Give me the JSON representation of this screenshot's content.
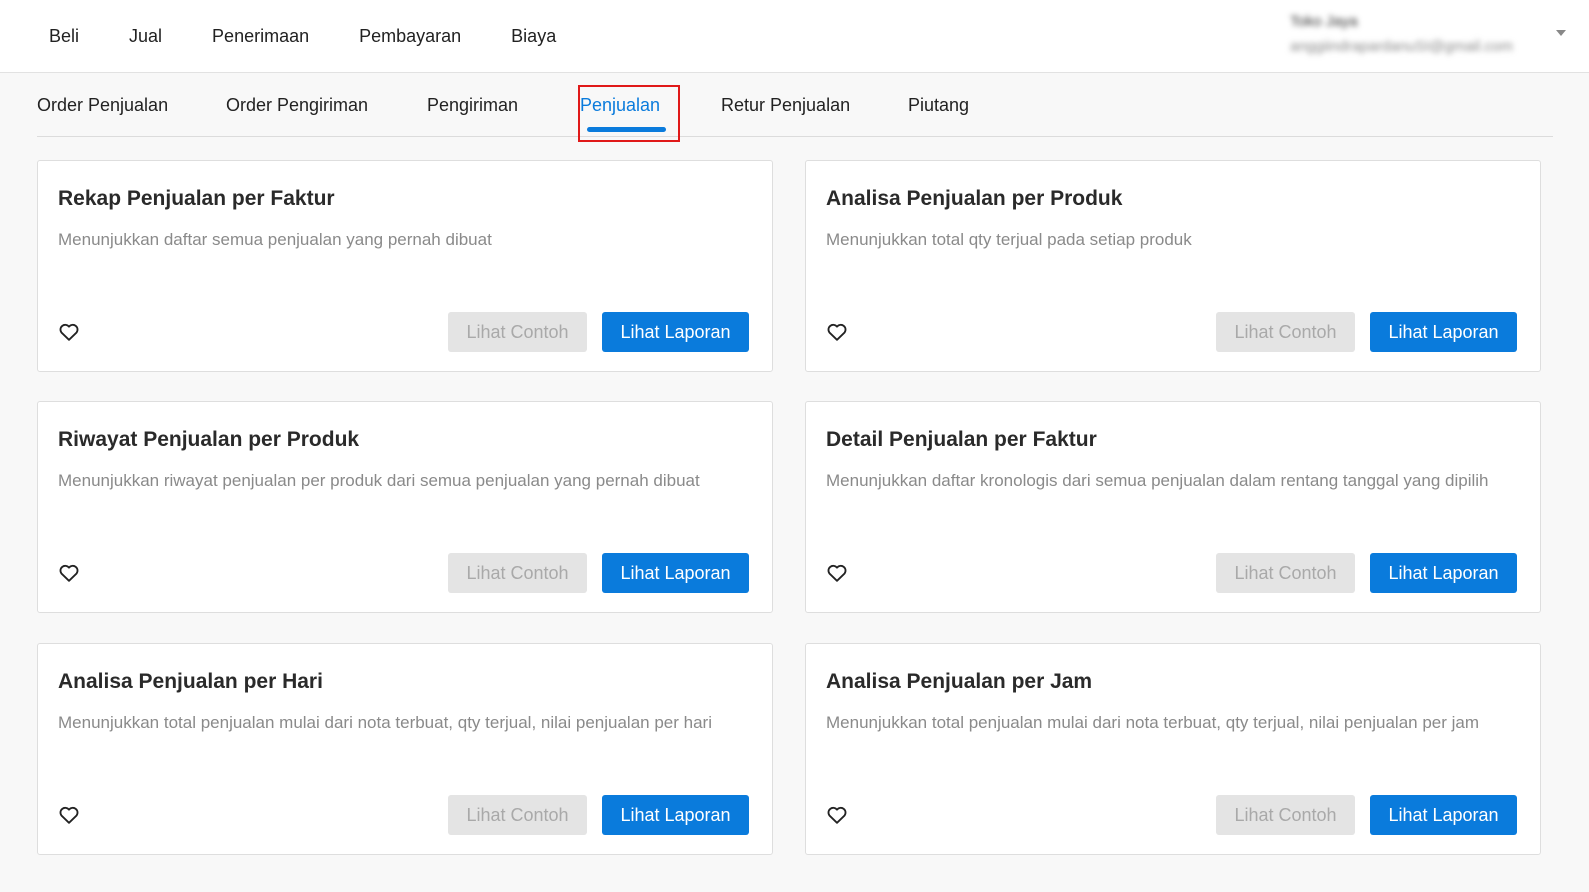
{
  "topnav": {
    "items": [
      {
        "label": "Beli"
      },
      {
        "label": "Jual"
      },
      {
        "label": "Penerimaan"
      },
      {
        "label": "Pembayaran"
      },
      {
        "label": "Biaya"
      }
    ]
  },
  "user": {
    "name": "Toko Jaya",
    "email": "anggiindrapardanuSI@gmail.com",
    "caret_icon": "caret-down-icon"
  },
  "subtabs": {
    "active_index": 3,
    "items": [
      {
        "label": "Order Penjualan"
      },
      {
        "label": "Order Pengiriman"
      },
      {
        "label": "Pengiriman"
      },
      {
        "label": "Penjualan"
      },
      {
        "label": "Retur Penjualan"
      },
      {
        "label": "Piutang"
      }
    ]
  },
  "colors": {
    "accent": "#0a7bdc",
    "highlight_box": "#e01919",
    "disabled_button": "#e4e4e4"
  },
  "cards": [
    {
      "title": "Rekap Penjualan per Faktur",
      "description": "Menunjukkan daftar semua penjualan yang pernah dibuat",
      "example_label": "Lihat Contoh",
      "report_label": "Lihat Laporan",
      "favorite_icon": "heart-icon"
    },
    {
      "title": "Analisa Penjualan per Produk",
      "description": "Menunjukkan total qty terjual pada setiap produk",
      "example_label": "Lihat Contoh",
      "report_label": "Lihat Laporan",
      "favorite_icon": "heart-icon"
    },
    {
      "title": "Riwayat Penjualan per Produk",
      "description": "Menunjukkan riwayat penjualan per produk dari semua penjualan yang pernah dibuat",
      "example_label": "Lihat Contoh",
      "report_label": "Lihat Laporan",
      "favorite_icon": "heart-icon"
    },
    {
      "title": "Detail Penjualan per Faktur",
      "description": "Menunjukkan daftar kronologis dari semua penjualan dalam rentang tanggal yang dipilih",
      "example_label": "Lihat Contoh",
      "report_label": "Lihat Laporan",
      "favorite_icon": "heart-icon"
    },
    {
      "title": "Analisa Penjualan per Hari",
      "description": "Menunjukkan total penjualan mulai dari nota terbuat, qty terjual, nilai penjualan per hari",
      "example_label": "Lihat Contoh",
      "report_label": "Lihat Laporan",
      "favorite_icon": "heart-icon"
    },
    {
      "title": "Analisa Penjualan per Jam",
      "description": "Menunjukkan total penjualan mulai dari nota terbuat, qty terjual, nilai penjualan per jam",
      "example_label": "Lihat Contoh",
      "report_label": "Lihat Laporan",
      "favorite_icon": "heart-icon"
    }
  ]
}
